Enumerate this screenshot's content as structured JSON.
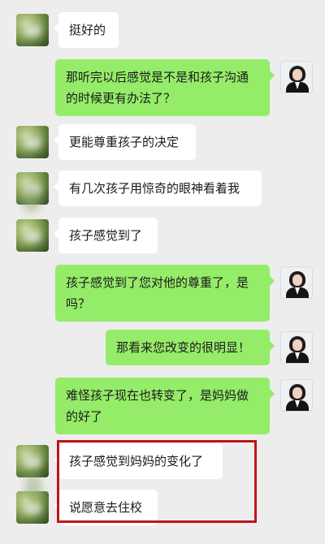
{
  "chat": {
    "messages": [
      {
        "sender": "friend",
        "text": "挺好的"
      },
      {
        "sender": "self",
        "text": "那听完以后感觉是不是和孩子沟通的时候更有办法了？"
      },
      {
        "sender": "friend",
        "text": "更能尊重孩子的决定"
      },
      {
        "sender": "friend",
        "text": "有几次孩子用惊奇的眼神看着我"
      },
      {
        "sender": "friend",
        "text": "孩子感觉到了"
      },
      {
        "sender": "self",
        "text": "孩子感觉到了您对他的尊重了，是吗？"
      },
      {
        "sender": "self",
        "text": "那看来您改变的很明显！"
      },
      {
        "sender": "self",
        "text": "难怪孩子现在也转变了，是妈妈做的好了"
      },
      {
        "sender": "friend",
        "text": "孩子感觉到妈妈的变化了"
      },
      {
        "sender": "friend",
        "text": "说愿意去住校"
      }
    ]
  },
  "colors": {
    "background": "#ededed",
    "self_bubble": "#95ec69",
    "friend_bubble": "#ffffff",
    "highlight_border": "#c0141c"
  },
  "icons": {
    "friend_avatar": "blurred-avatar",
    "self_avatar": "consultant-avatar"
  }
}
